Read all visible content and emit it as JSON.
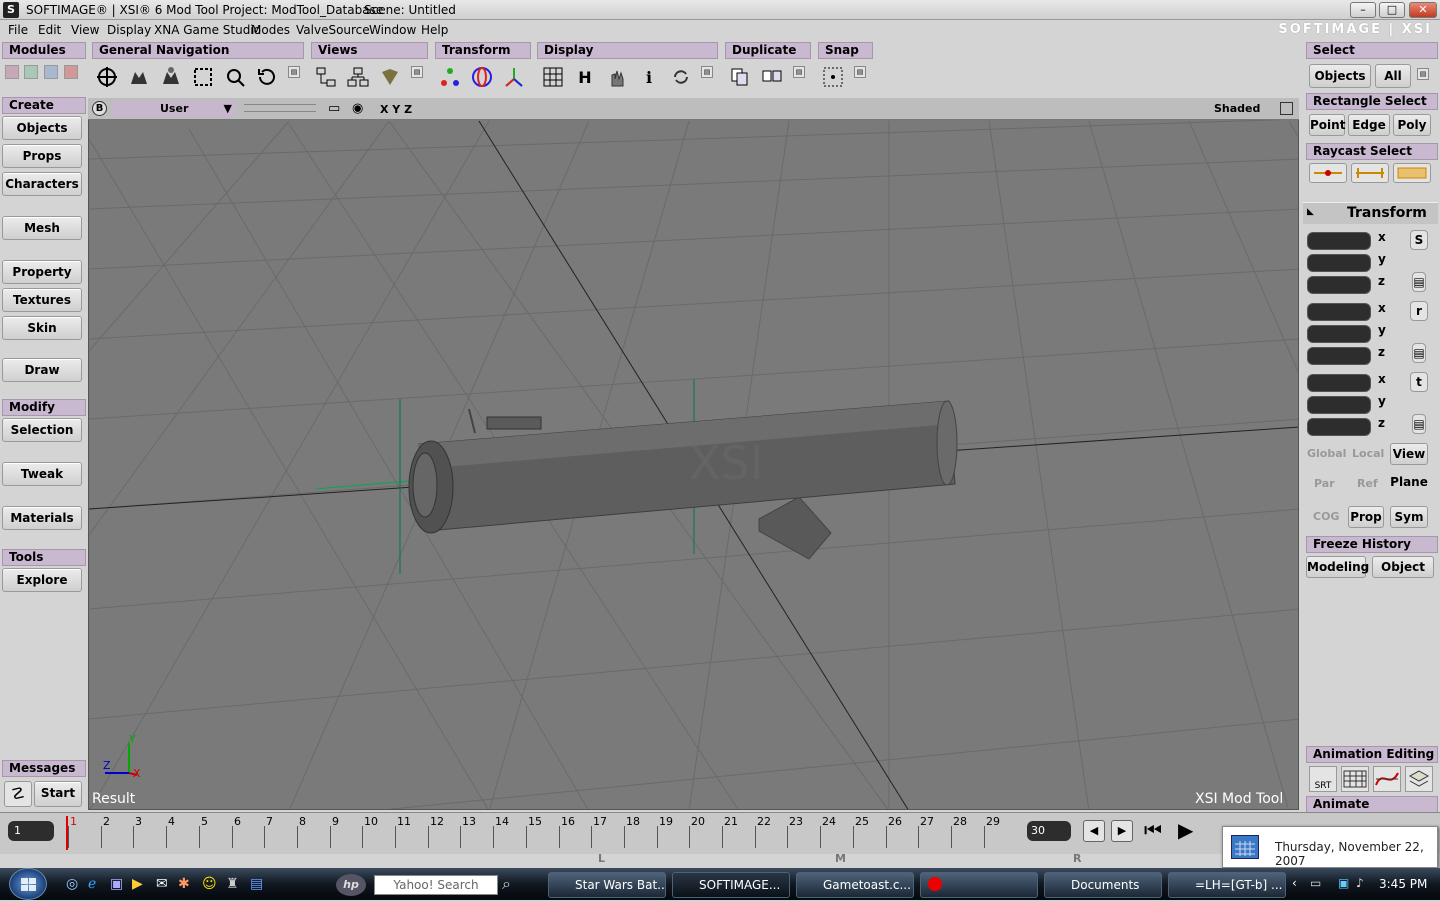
{
  "window": {
    "title": "SOFTIMAGE® | XSI® 6 Mod Tool Project: ModTool_Database",
    "scene": "Scene: Untitled",
    "brand": "SOFTIMAGE | XSI",
    "min": "–",
    "max": "□",
    "close": "✕"
  },
  "menu": [
    "File",
    "Edit",
    "View",
    "Display",
    "XNA Game Studio",
    "Modes",
    "ValveSource",
    "Window",
    "Help"
  ],
  "toolbar": {
    "modules": "Modules",
    "general_navigation": "General Navigation",
    "views": "Views",
    "transform": "Transform",
    "display": "Display",
    "duplicate": "Duplicate",
    "snap": "Snap",
    "select": "Select",
    "objects": "Objects",
    "all": "All",
    "h_label": "H",
    "i_label": "i"
  },
  "left": {
    "create": "Create",
    "objects": "Objects",
    "props": "Props",
    "characters": "Characters",
    "mesh": "Mesh",
    "property": "Property",
    "textures": "Textures",
    "skin": "Skin",
    "draw": "Draw",
    "modify": "Modify",
    "selection": "Selection",
    "tweak": "Tweak",
    "materials": "Materials",
    "tools": "Tools",
    "explore": "Explore",
    "messages": "Messages",
    "start": "Start"
  },
  "viewport": {
    "camera_badge": "B",
    "camera": "User",
    "xyz": "X Y Z",
    "shading": "Shaded",
    "result": "Result",
    "watermark": "XSI Mod Tool",
    "axis_y": "Y",
    "axis_z": "Z",
    "axis_x": "X"
  },
  "right": {
    "rect_select": "Rectangle Select",
    "point": "Point",
    "edge": "Edge",
    "poly": "Poly",
    "raycast_select": "Raycast Select",
    "transform": "Transform",
    "x": "x",
    "y": "y",
    "z": "z",
    "s": "S",
    "r": "r",
    "t": "t",
    "global": "Global",
    "local": "Local",
    "view": "View",
    "par": "Par",
    "ref": "Ref",
    "plane": "Plane",
    "cog": "COG",
    "prop": "Prop",
    "sym": "Sym",
    "freeze_history": "Freeze History",
    "modeling": "Modeling",
    "object": "Object",
    "animation_editing": "Animation Editing",
    "srt": "SRT",
    "animate": "Animate"
  },
  "timeline": {
    "current_frame": "1",
    "end_frame": "30",
    "ticks": [
      "1",
      "2",
      "3",
      "4",
      "5",
      "6",
      "7",
      "8",
      "9",
      "10",
      "11",
      "12",
      "13",
      "14",
      "15",
      "16",
      "17",
      "18",
      "19",
      "20",
      "21",
      "22",
      "23",
      "24",
      "25",
      "26",
      "27",
      "28",
      "29"
    ],
    "markers": [
      "L",
      "M",
      "R"
    ]
  },
  "taskbar": {
    "search": "Yahoo! Search",
    "tasks": [
      "Star Wars Bat...",
      "SOFTIMAGE...",
      "Gametoast.c...",
      "",
      "Documents",
      "=LH=[GT-b] ..."
    ],
    "clock": "3:45 PM",
    "date_tooltip": "Thursday, November 22, 2007"
  }
}
